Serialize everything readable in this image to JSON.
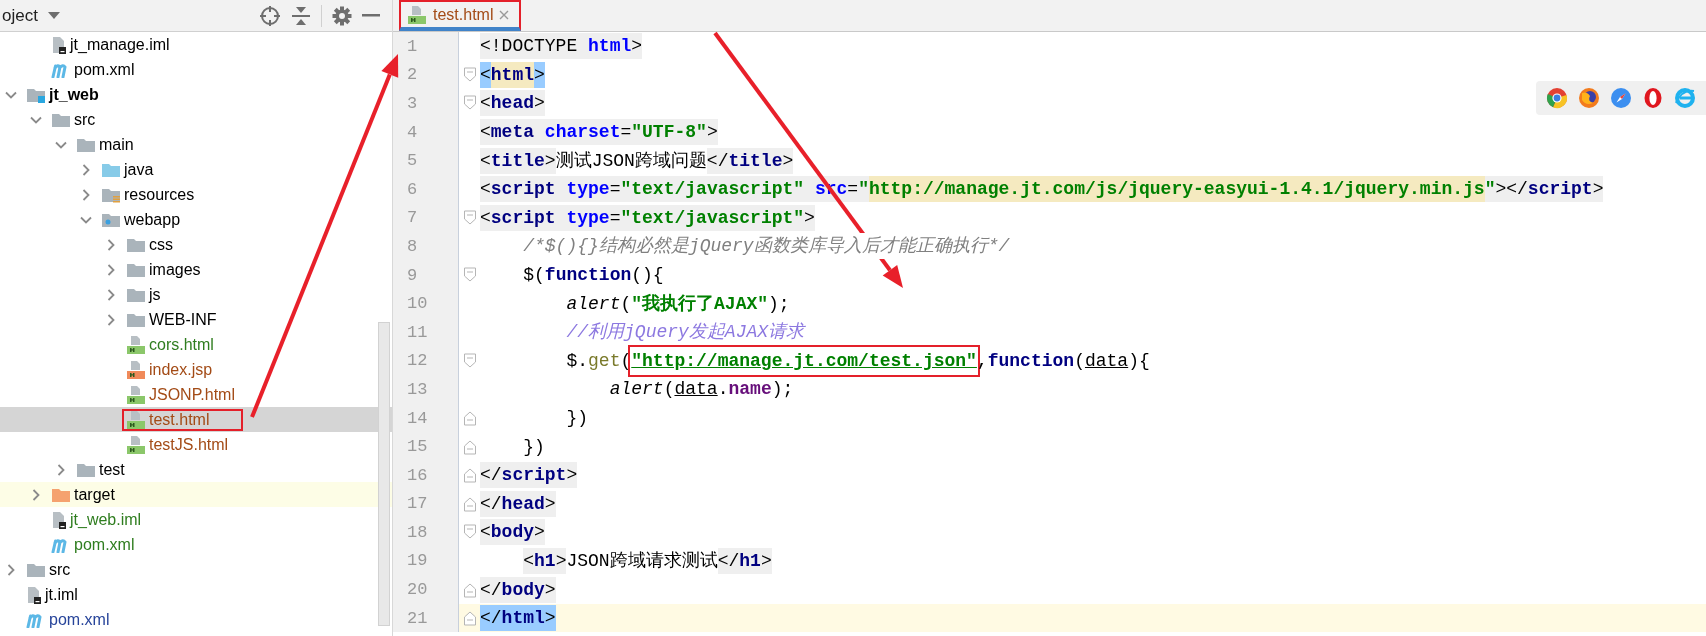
{
  "project_panel": {
    "title": "oject",
    "tree": [
      {
        "children": [
          {
            "label": "jt_manage.iml",
            "kind": "iml",
            "color": "#000000",
            "selected": false,
            "highlighted": false,
            "outlined": false
          },
          {
            "label": "pom.xml",
            "kind": "maven",
            "color": "#000000",
            "selected": false,
            "highlighted": false,
            "outlined": false
          }
        ]
      },
      {
        "label": "jt_web",
        "kind": "module",
        "color": "#000000",
        "expanded": true,
        "selected": false,
        "highlighted": false,
        "outlined": false,
        "children": [
          {
            "label": "src",
            "kind": "folder",
            "color": "#000000",
            "expanded": true,
            "selected": false,
            "highlighted": false,
            "outlined": false,
            "children": [
              {
                "label": "main",
                "kind": "folder",
                "color": "#000000",
                "expanded": true,
                "selected": false,
                "highlighted": false,
                "outlined": false,
                "children": [
                  {
                    "label": "java",
                    "kind": "source-folder",
                    "color": "#000000",
                    "expanded": false,
                    "selected": false,
                    "highlighted": false,
                    "outlined": false
                  },
                  {
                    "label": "resources",
                    "kind": "resource-folder",
                    "color": "#000000",
                    "expanded": false,
                    "selected": false,
                    "highlighted": false,
                    "outlined": false
                  },
                  {
                    "label": "webapp",
                    "kind": "web-folder",
                    "color": "#000000",
                    "expanded": true,
                    "selected": false,
                    "highlighted": false,
                    "outlined": false,
                    "children": [
                      {
                        "label": "css",
                        "kind": "folder",
                        "color": "#000000",
                        "expanded": false,
                        "selected": false,
                        "highlighted": false,
                        "outlined": false
                      },
                      {
                        "label": "images",
                        "kind": "folder",
                        "color": "#000000",
                        "expanded": false,
                        "selected": false,
                        "highlighted": false,
                        "outlined": false
                      },
                      {
                        "label": "js",
                        "kind": "folder",
                        "color": "#000000",
                        "expanded": false,
                        "selected": false,
                        "highlighted": false,
                        "outlined": false
                      },
                      {
                        "label": "WEB-INF",
                        "kind": "folder",
                        "color": "#000000",
                        "expanded": false,
                        "selected": false,
                        "highlighted": false,
                        "outlined": false
                      },
                      {
                        "label": "cors.html",
                        "kind": "html",
                        "color": "#2f7d1f",
                        "selected": false,
                        "highlighted": false,
                        "outlined": false
                      },
                      {
                        "label": "index.jsp",
                        "kind": "jsp",
                        "color": "#a34b16",
                        "selected": false,
                        "highlighted": false,
                        "outlined": false
                      },
                      {
                        "label": "JSONP.html",
                        "kind": "html",
                        "color": "#a34b16",
                        "selected": false,
                        "highlighted": false,
                        "outlined": false
                      },
                      {
                        "label": "test.html",
                        "kind": "html",
                        "color": "#a34b16",
                        "selected": true,
                        "highlighted": false,
                        "outlined": true
                      },
                      {
                        "label": "testJS.html",
                        "kind": "html",
                        "color": "#a34b16",
                        "selected": false,
                        "highlighted": false,
                        "outlined": false
                      }
                    ]
                  }
                ]
              },
              {
                "label": "test",
                "kind": "folder",
                "color": "#000000",
                "expanded": false,
                "selected": false,
                "highlighted": false,
                "outlined": false
              }
            ]
          },
          {
            "label": "target",
            "kind": "excluded-folder",
            "color": "#000000",
            "expanded": false,
            "selected": false,
            "highlighted": true,
            "outlined": false
          },
          {
            "label": "jt_web.iml",
            "kind": "iml",
            "color": "#2f7d1f",
            "selected": false,
            "highlighted": false,
            "outlined": false
          },
          {
            "label": "pom.xml",
            "kind": "maven",
            "color": "#2f7d1f",
            "selected": false,
            "highlighted": false,
            "outlined": false
          }
        ]
      },
      {
        "label": "src",
        "kind": "folder",
        "color": "#000000",
        "expanded": false,
        "selected": false,
        "highlighted": false,
        "outlined": false
      },
      {
        "label": "jt.iml",
        "kind": "iml",
        "color": "#000000",
        "selected": false,
        "highlighted": false,
        "outlined": false
      },
      {
        "label": "pom.xml",
        "kind": "maven",
        "color": "#27449a",
        "selected": false,
        "highlighted": false,
        "outlined": false
      }
    ]
  },
  "tabs": [
    {
      "label": "test.html",
      "kind": "html",
      "color": "#a34b16",
      "selected": true,
      "outlined": true
    }
  ],
  "editor": {
    "lines": [
      {
        "number": "1",
        "kind": "plain",
        "current": false,
        "tokens": [
          {
            "kind": "punct",
            "text": "<!DOCTYPE ",
            "shaded": true
          },
          {
            "kind": "attr",
            "text": "html",
            "shaded": true
          },
          {
            "kind": "punct",
            "text": ">",
            "shaded": true
          }
        ]
      },
      {
        "number": "2",
        "kind": "fold-start",
        "current": false,
        "tokens": [
          {
            "kind": "punct",
            "text": "<",
            "matched": true
          },
          {
            "kind": "tag",
            "text": "html",
            "highlighted": true
          },
          {
            "kind": "punct",
            "text": ">",
            "matched": true
          }
        ]
      },
      {
        "number": "3",
        "kind": "fold-start",
        "current": false,
        "tokens": [
          {
            "kind": "punct",
            "text": "<",
            "shaded": true
          },
          {
            "kind": "tag",
            "text": "head",
            "shaded": true
          },
          {
            "kind": "punct",
            "text": ">",
            "shaded": true
          }
        ]
      },
      {
        "number": "4",
        "kind": "plain",
        "current": false,
        "tokens": [
          {
            "kind": "punct",
            "text": "<",
            "shaded": true
          },
          {
            "kind": "tag",
            "text": "meta ",
            "shaded": true
          },
          {
            "kind": "attr",
            "text": "charset",
            "shaded": true
          },
          {
            "kind": "punct",
            "text": "=",
            "shaded": true
          },
          {
            "kind": "string",
            "text": "\"UTF-8\"",
            "shaded": true
          },
          {
            "kind": "punct",
            "text": ">",
            "shaded": true
          }
        ]
      },
      {
        "number": "5",
        "kind": "plain",
        "current": false,
        "tokens": [
          {
            "kind": "punct",
            "text": "<",
            "shaded": true
          },
          {
            "kind": "tag",
            "text": "title",
            "shaded": true
          },
          {
            "kind": "punct",
            "text": ">",
            "shaded": true
          },
          {
            "kind": "text",
            "text": "测试JSON跨域问题"
          },
          {
            "kind": "punct",
            "text": "</",
            "shaded": true
          },
          {
            "kind": "tag",
            "text": "title",
            "shaded": true
          },
          {
            "kind": "punct",
            "text": ">",
            "shaded": true
          }
        ]
      },
      {
        "number": "6",
        "kind": "plain",
        "current": false,
        "tokens": [
          {
            "kind": "punct",
            "text": "<",
            "shaded": true
          },
          {
            "kind": "tag",
            "text": "script ",
            "shaded": true
          },
          {
            "kind": "attr",
            "text": "type",
            "shaded": true
          },
          {
            "kind": "punct",
            "text": "=",
            "shaded": true
          },
          {
            "kind": "string",
            "text": "\"text/javascript\" ",
            "shaded": true
          },
          {
            "kind": "attr",
            "text": "src",
            "shaded": true
          },
          {
            "kind": "punct",
            "text": "=",
            "shaded": true
          },
          {
            "kind": "string",
            "text": "\"",
            "shaded": true
          },
          {
            "kind": "string",
            "text": "http://manage.jt.com/js/jquery-easyui-1.4.1/jquery.min.js",
            "highlighted": true
          },
          {
            "kind": "string",
            "text": "\"",
            "shaded": true
          },
          {
            "kind": "punct",
            "text": "></",
            "shaded": true
          },
          {
            "kind": "tag",
            "text": "script",
            "shaded": true
          },
          {
            "kind": "punct",
            "text": ">",
            "shaded": true
          }
        ]
      },
      {
        "number": "7",
        "kind": "fold-start",
        "current": false,
        "tokens": [
          {
            "kind": "punct",
            "text": "<",
            "shaded": true
          },
          {
            "kind": "tag",
            "text": "script ",
            "shaded": true
          },
          {
            "kind": "attr",
            "text": "type",
            "shaded": true
          },
          {
            "kind": "punct",
            "text": "=",
            "shaded": true
          },
          {
            "kind": "string",
            "text": "\"text/javascript\"",
            "shaded": true
          },
          {
            "kind": "punct",
            "text": ">",
            "shaded": true
          }
        ]
      },
      {
        "number": "8",
        "kind": "plain",
        "current": false,
        "tokens": [
          {
            "kind": "comment",
            "text": "    /*$(){}结构必然是jQuery函数类库导入后才能正确执行*/"
          }
        ]
      },
      {
        "number": "9",
        "kind": "fold-start",
        "current": false,
        "tokens": [
          {
            "kind": "text",
            "text": "    $("
          },
          {
            "kind": "keyword",
            "text": "function"
          },
          {
            "kind": "text",
            "text": "(){"
          }
        ]
      },
      {
        "number": "10",
        "kind": "plain",
        "current": false,
        "tokens": [
          {
            "kind": "call",
            "text": "        alert"
          },
          {
            "kind": "text",
            "text": "("
          },
          {
            "kind": "string",
            "text": "\"我执行了AJAX\""
          },
          {
            "kind": "text",
            "text": ");"
          }
        ]
      },
      {
        "number": "11",
        "kind": "plain",
        "current": false,
        "tokens": [
          {
            "kind": "comment-line",
            "text": "        //利用jQuery发起AJAX请求"
          }
        ]
      },
      {
        "number": "12",
        "kind": "fold-start",
        "current": false,
        "tokens": [
          {
            "kind": "text",
            "text": "        $."
          },
          {
            "kind": "method",
            "text": "get"
          },
          {
            "kind": "text",
            "text": "("
          },
          {
            "kind": "link",
            "text": "\"http://manage.jt.com/test.json\"",
            "outlined": true
          },
          {
            "kind": "text",
            "text": ","
          },
          {
            "kind": "keyword",
            "text": "function"
          },
          {
            "kind": "text",
            "text": "("
          },
          {
            "kind": "param",
            "text": "data"
          },
          {
            "kind": "text",
            "text": "){"
          }
        ]
      },
      {
        "number": "13",
        "kind": "plain",
        "current": false,
        "tokens": [
          {
            "kind": "call",
            "text": "            alert"
          },
          {
            "kind": "text",
            "text": "("
          },
          {
            "kind": "param",
            "text": "data"
          },
          {
            "kind": "text",
            "text": "."
          },
          {
            "kind": "property",
            "text": "name"
          },
          {
            "kind": "text",
            "text": ");"
          }
        ]
      },
      {
        "number": "14",
        "kind": "fold-end",
        "current": false,
        "tokens": [
          {
            "kind": "text",
            "text": "        })"
          }
        ]
      },
      {
        "number": "15",
        "kind": "fold-end",
        "current": false,
        "tokens": [
          {
            "kind": "text",
            "text": "    })"
          }
        ]
      },
      {
        "number": "16",
        "kind": "fold-end",
        "current": false,
        "tokens": [
          {
            "kind": "punct",
            "text": "</",
            "shaded": true
          },
          {
            "kind": "tag",
            "text": "script",
            "shaded": true
          },
          {
            "kind": "punct",
            "text": ">",
            "shaded": true
          }
        ]
      },
      {
        "number": "17",
        "kind": "fold-end",
        "current": false,
        "tokens": [
          {
            "kind": "punct",
            "text": "</",
            "shaded": true
          },
          {
            "kind": "tag",
            "text": "head",
            "shaded": true
          },
          {
            "kind": "punct",
            "text": ">",
            "shaded": true
          }
        ]
      },
      {
        "number": "18",
        "kind": "fold-start",
        "current": false,
        "tokens": [
          {
            "kind": "punct",
            "text": "<",
            "shaded": true
          },
          {
            "kind": "tag",
            "text": "body",
            "shaded": true
          },
          {
            "kind": "punct",
            "text": ">",
            "shaded": true
          }
        ]
      },
      {
        "number": "19",
        "kind": "plain",
        "current": false,
        "tokens": [
          {
            "kind": "punct",
            "text": "    <",
            "shaded": true
          },
          {
            "kind": "tag",
            "text": "h1",
            "shaded": true
          },
          {
            "kind": "punct",
            "text": ">",
            "shaded": true
          },
          {
            "kind": "text",
            "text": "JSON跨域请求测试"
          },
          {
            "kind": "punct",
            "text": "</",
            "shaded": true
          },
          {
            "kind": "tag",
            "text": "h1",
            "shaded": true
          },
          {
            "kind": "punct",
            "text": ">",
            "shaded": true
          }
        ]
      },
      {
        "number": "20",
        "kind": "fold-end",
        "current": false,
        "tokens": [
          {
            "kind": "punct",
            "text": "</",
            "shaded": true
          },
          {
            "kind": "tag",
            "text": "body",
            "shaded": true
          },
          {
            "kind": "punct",
            "text": ">",
            "shaded": true
          }
        ]
      },
      {
        "number": "21",
        "kind": "fold-end",
        "current": true,
        "tokens": [
          {
            "kind": "punct",
            "text": "</",
            "matched": true
          },
          {
            "kind": "tag",
            "text": "html",
            "matched": true
          },
          {
            "kind": "punct",
            "text": ">",
            "matched": true
          }
        ]
      }
    ]
  }
}
